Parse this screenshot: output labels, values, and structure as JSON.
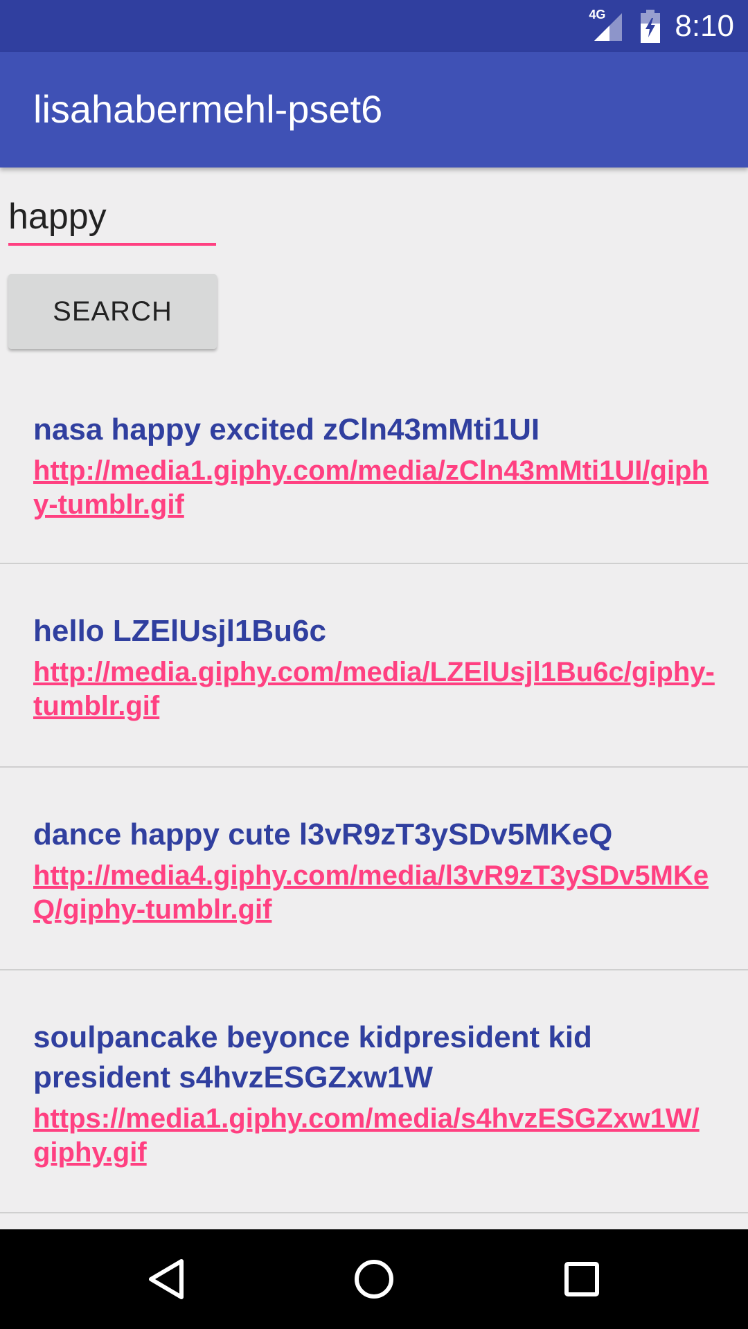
{
  "status_bar": {
    "time": "8:10",
    "network_label": "4G",
    "icons": [
      "signal-icon",
      "battery-charging-icon"
    ],
    "color": "#303f9f"
  },
  "app_bar": {
    "title": "lisahabermehl-pset6",
    "color": "#3f51b5"
  },
  "search": {
    "value": "happy",
    "button_label": "SEARCH",
    "accent_color": "#ff4081"
  },
  "results": [
    {
      "title": "nasa happy excited zCln43mMti1UI",
      "url": "http://media1.giphy.com/media/zCln43mMti1UI/giphy-tumblr.gif"
    },
    {
      "title": "hello LZElUsjl1Bu6c",
      "url": "http://media.giphy.com/media/LZElUsjl1Bu6c/giphy-tumblr.gif"
    },
    {
      "title": "dance happy cute l3vR9zT3ySDv5MKeQ",
      "url": "http://media4.giphy.com/media/l3vR9zT3ySDv5MKeQ/giphy-tumblr.gif"
    },
    {
      "title": "soulpancake beyonce kidpresident kid president s4hvzESGZxw1W",
      "url": "https://media1.giphy.com/media/s4hvzESGZxw1W/giphy.gif"
    }
  ],
  "nav_bar": {
    "icons": [
      "back-icon",
      "home-icon",
      "recents-icon"
    ]
  }
}
